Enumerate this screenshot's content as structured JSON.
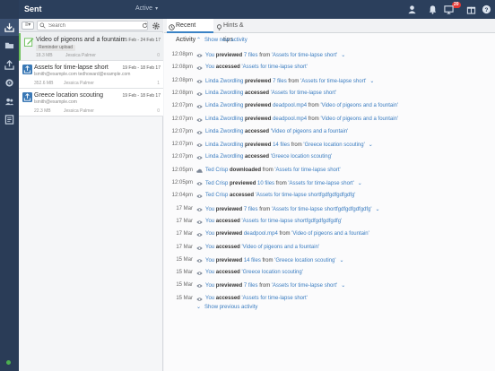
{
  "header": {
    "title": "Sent",
    "filter": "Active",
    "notification_count": "20"
  },
  "list": {
    "search_placeholder": "Search",
    "items": [
      {
        "title": "Video of pigeons and a fountain",
        "date": "25 Feb - 24 Feb 17",
        "sub": "Reminder upload",
        "size": "18.3 MB",
        "owner": "Jessica Palmer",
        "count": "0"
      },
      {
        "title": "Assets for time-lapse short",
        "date": "19 Feb - 18 Feb 17",
        "sub": "lsmith@example.com  tedhoward@example.com",
        "size": "352.6 MB",
        "owner": "Jessica Palmer",
        "count": "1"
      },
      {
        "title": "Greece location scouting",
        "date": "19 Feb - 18 Feb 17",
        "sub": "lsmith@example.com",
        "size": "22.3 MB",
        "owner": "Jessica Palmer",
        "count": "0"
      }
    ]
  },
  "tabs": {
    "recent": "Recent Activity",
    "hints": "Hints & tips"
  },
  "activity": {
    "show_new": "Show new activity",
    "show_previous": "Show previous activity",
    "rows": [
      {
        "time": "12:08pm",
        "icon": "eye-icon",
        "who": "You",
        "action": "previewed",
        "count": "7 files",
        "mid": "from",
        "target": "'Assets for time-lapse short'",
        "expand": "yes"
      },
      {
        "time": "12:08pm",
        "icon": "eye-icon",
        "who": "You",
        "action": "accessed",
        "count": "",
        "mid": "",
        "target": "'Assets for time-lapse short'",
        "expand": ""
      },
      {
        "time": "12:08pm",
        "icon": "eye-icon",
        "who": "Linda Zwordling",
        "action": "previewed",
        "count": "7 files",
        "mid": "from",
        "target": "'Assets for time-lapse short'",
        "expand": "yes"
      },
      {
        "time": "12:08pm",
        "icon": "eye-icon",
        "who": "Linda Zwordling",
        "action": "accessed",
        "count": "",
        "mid": "",
        "target": "'Assets for time-lapse short'",
        "expand": ""
      },
      {
        "time": "12:07pm",
        "icon": "eye-icon",
        "who": "Linda Zwordling",
        "action": "previewed",
        "count": "deadpool.mp4",
        "mid": "from",
        "target": "'Video of pigeons and a fountain'",
        "expand": ""
      },
      {
        "time": "12:07pm",
        "icon": "eye-icon",
        "who": "Linda Zwordling",
        "action": "previewed",
        "count": "deadpool.mp4",
        "mid": "from",
        "target": "'Video of pigeons and a fountain'",
        "expand": ""
      },
      {
        "time": "12:07pm",
        "icon": "eye-icon",
        "who": "Linda Zwordling",
        "action": "accessed",
        "count": "",
        "mid": "",
        "target": "'Video of pigeons and a fountain'",
        "expand": ""
      },
      {
        "time": "12:07pm",
        "icon": "eye-icon",
        "who": "Linda Zwordling",
        "action": "previewed",
        "count": "14 files",
        "mid": "from",
        "target": "'Greece location scouting'",
        "expand": "yes"
      },
      {
        "time": "12:07pm",
        "icon": "eye-icon",
        "who": "Linda Zwordling",
        "action": "accessed",
        "count": "",
        "mid": "",
        "target": "'Greece location scouting'",
        "expand": ""
      },
      {
        "time": "12:05pm",
        "icon": "cloud-download-icon",
        "who": "Ted Crisp",
        "action": "downloaded",
        "count": "",
        "mid": "from",
        "target": "'Assets for time-lapse short'",
        "expand": ""
      },
      {
        "time": "12:05pm",
        "icon": "eye-icon",
        "who": "Ted Crisp",
        "action": "previewed",
        "count": "10 files",
        "mid": "from",
        "target": "'Assets for time-lapse short'",
        "expand": "yes"
      },
      {
        "time": "12:04pm",
        "icon": "eye-icon",
        "who": "Ted Crisp",
        "action": "accessed",
        "count": "",
        "mid": "",
        "target": "'Assets for time-lapse shortfgdfgdfgdfgdfg'",
        "expand": ""
      },
      {
        "time": "17 Mar",
        "icon": "eye-icon",
        "who": "You",
        "action": "previewed",
        "count": "7 files",
        "mid": "from",
        "target": "'Assets for time-lapse shortfgdfgdfgdfgdfg'",
        "expand": "yes"
      },
      {
        "time": "17 Mar",
        "icon": "eye-icon",
        "who": "You",
        "action": "accessed",
        "count": "",
        "mid": "",
        "target": "'Assets for time-lapse shortfgdfgdfgdfgdfg'",
        "expand": ""
      },
      {
        "time": "17 Mar",
        "icon": "eye-icon",
        "who": "You",
        "action": "previewed",
        "count": "deadpool.mp4",
        "mid": "from",
        "target": "'Video of pigeons and a fountain'",
        "expand": ""
      },
      {
        "time": "17 Mar",
        "icon": "eye-icon",
        "who": "You",
        "action": "accessed",
        "count": "",
        "mid": "",
        "target": "'Video of pigeons and a fountain'",
        "expand": ""
      },
      {
        "time": "15 Mar",
        "icon": "eye-icon",
        "who": "You",
        "action": "previewed",
        "count": "14 files",
        "mid": "from",
        "target": "'Greece location scouting'",
        "expand": "yes"
      },
      {
        "time": "15 Mar",
        "icon": "eye-icon",
        "who": "You",
        "action": "accessed",
        "count": "",
        "mid": "",
        "target": "'Greece location scouting'",
        "expand": ""
      },
      {
        "time": "15 Mar",
        "icon": "eye-icon",
        "who": "You",
        "action": "previewed",
        "count": "7 files",
        "mid": "from",
        "target": "'Assets for time-lapse short'",
        "expand": "yes"
      },
      {
        "time": "15 Mar",
        "icon": "eye-icon",
        "who": "You",
        "action": "accessed",
        "count": "",
        "mid": "",
        "target": "'Assets for time-lapse short'",
        "expand": ""
      }
    ]
  }
}
